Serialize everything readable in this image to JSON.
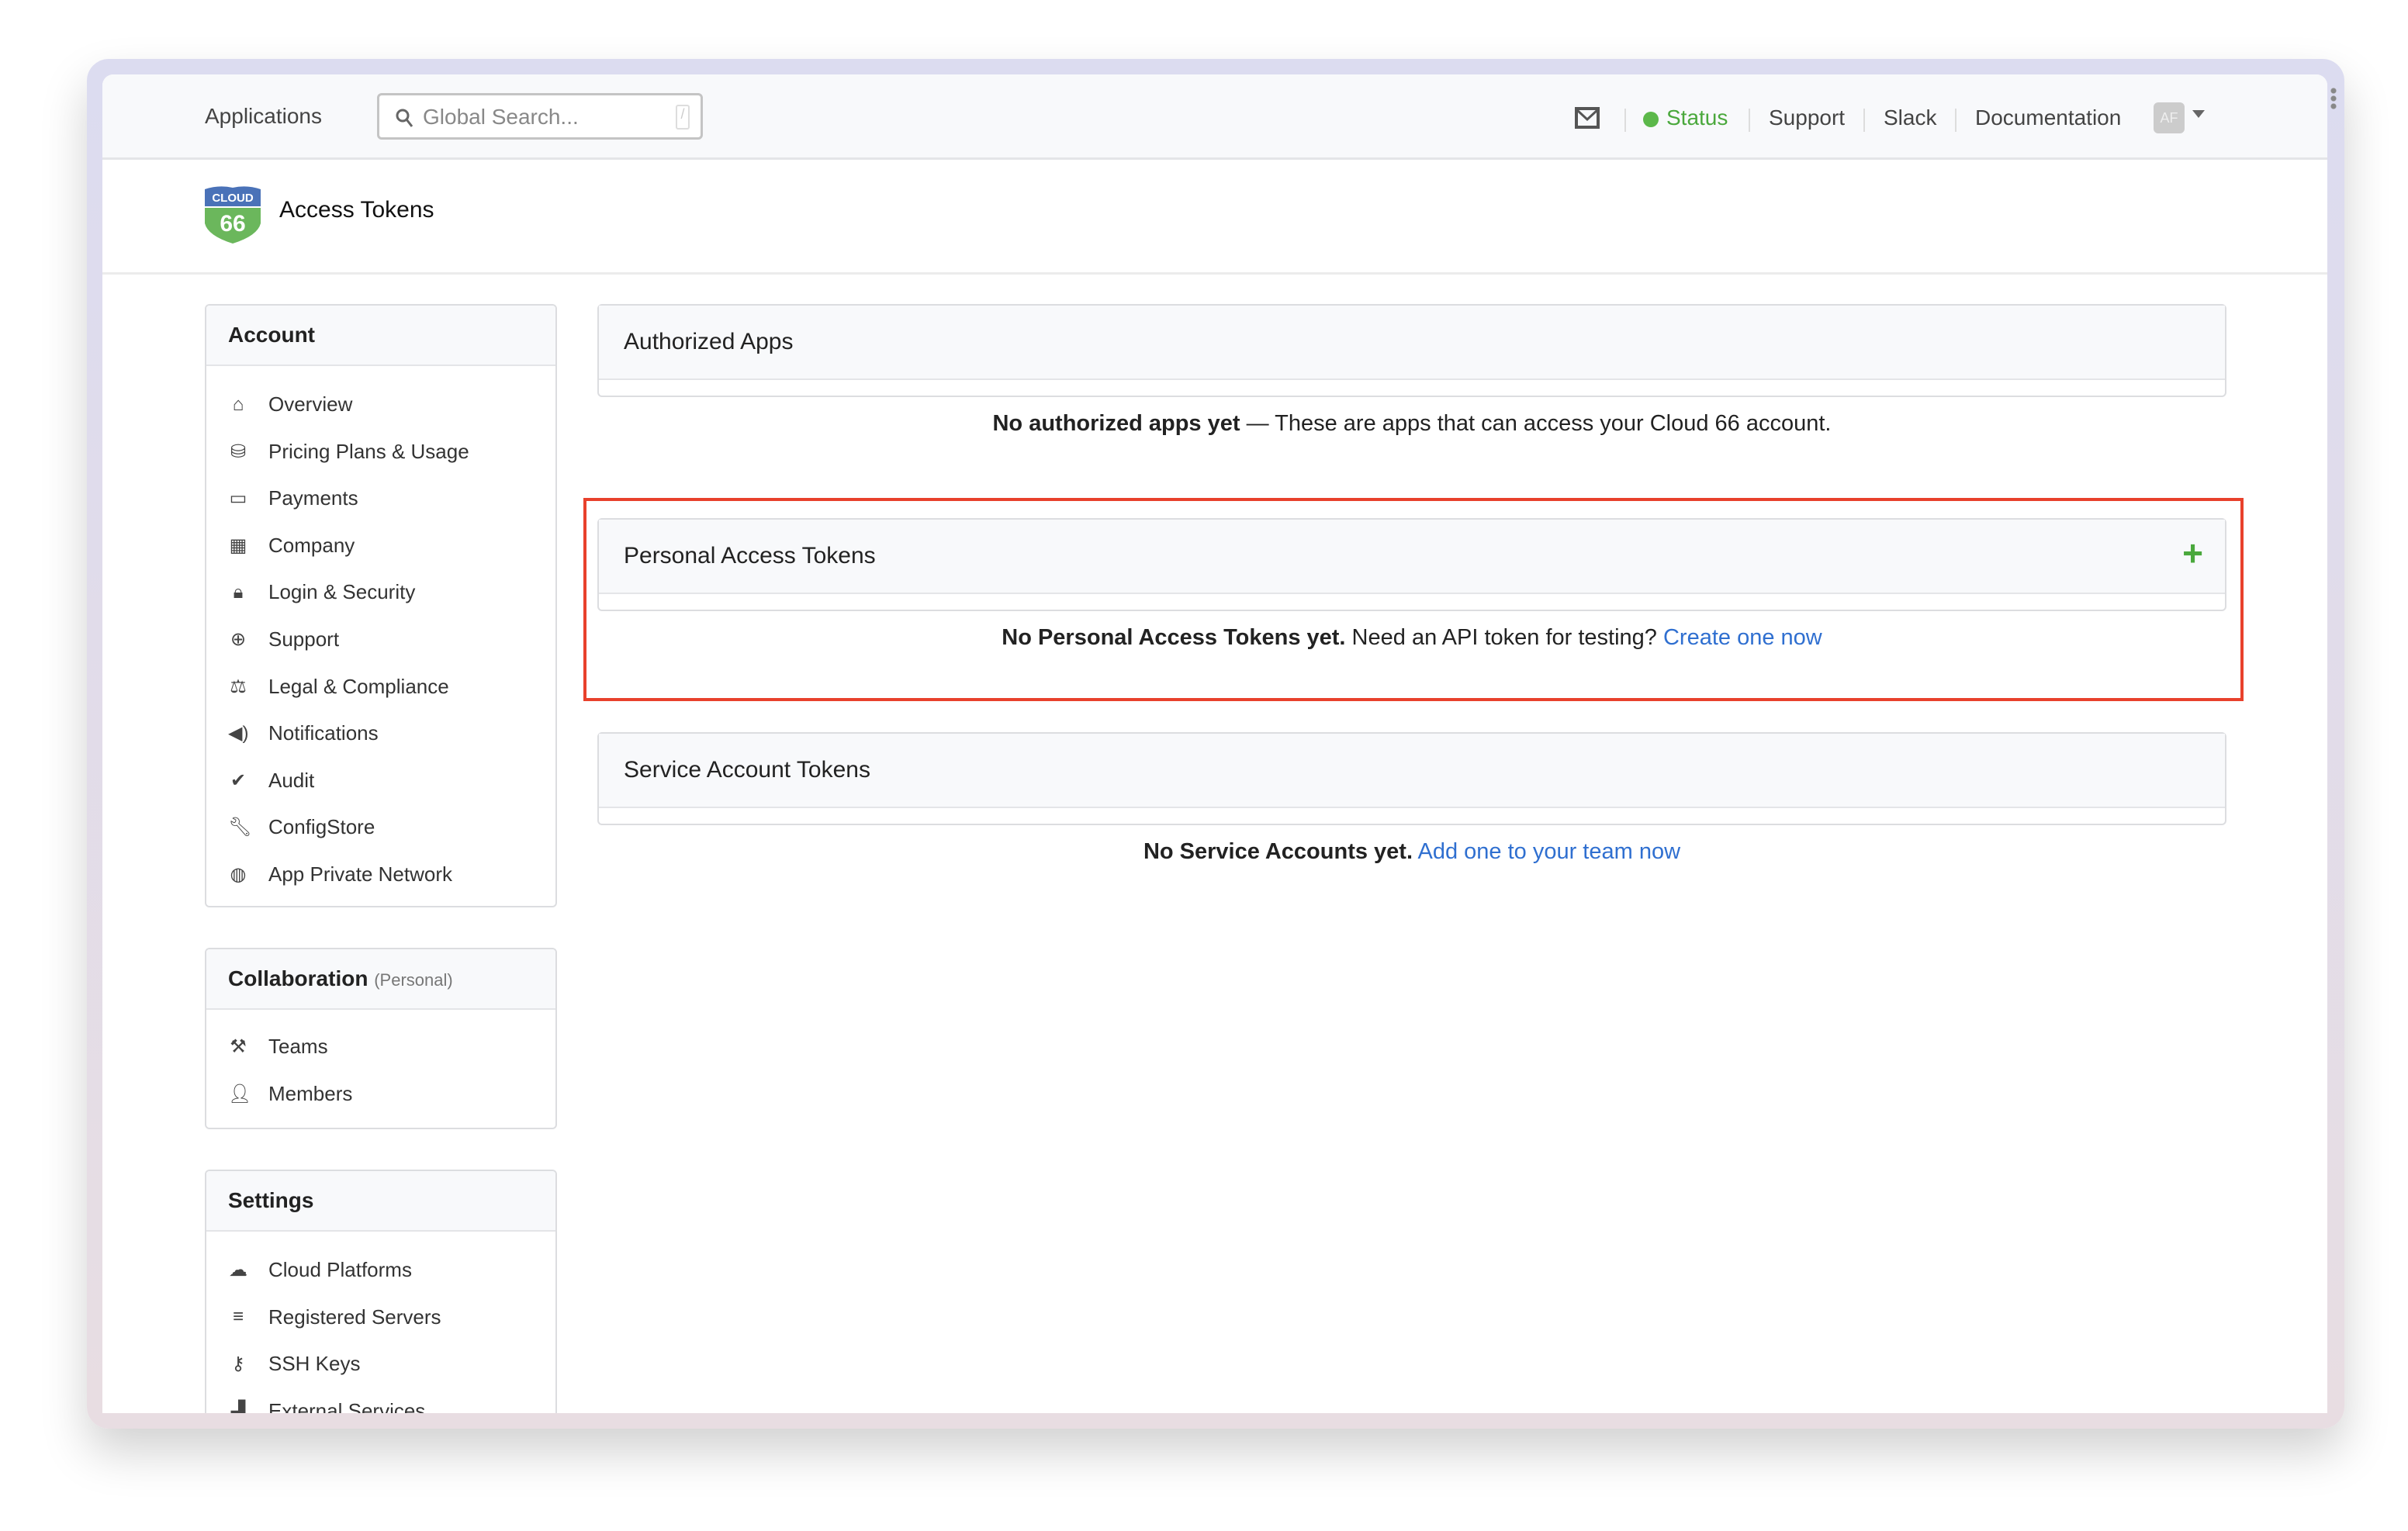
{
  "header": {
    "applications": "Applications",
    "search_placeholder": "Global Search...",
    "search_shortcut": "/",
    "status": "Status",
    "support": "Support",
    "slack": "Slack",
    "documentation": "Documentation",
    "avatar": "AF"
  },
  "logo": {
    "top": "CLOUD",
    "bottom": "66"
  },
  "page_title": "Access Tokens",
  "sidebar": {
    "account": {
      "title": "Account",
      "items": [
        {
          "label": "Overview",
          "icon": "home-icon"
        },
        {
          "label": "Pricing Plans & Usage",
          "icon": "coins-icon"
        },
        {
          "label": "Payments",
          "icon": "credit-card-icon"
        },
        {
          "label": "Company",
          "icon": "building-icon"
        },
        {
          "label": "Login & Security",
          "icon": "lock-icon"
        },
        {
          "label": "Support",
          "icon": "life-ring-icon"
        },
        {
          "label": "Legal & Compliance",
          "icon": "scale-icon"
        },
        {
          "label": "Notifications",
          "icon": "speaker-icon"
        },
        {
          "label": "Audit",
          "icon": "check-icon"
        },
        {
          "label": "ConfigStore",
          "icon": "wrench-icon"
        },
        {
          "label": "App Private Network",
          "icon": "globe-lock-icon"
        }
      ]
    },
    "collaboration": {
      "title": "Collaboration",
      "sub": "(Personal)",
      "items": [
        {
          "label": "Teams",
          "icon": "hammer-icon"
        },
        {
          "label": "Members",
          "icon": "user-icon"
        }
      ]
    },
    "settings": {
      "title": "Settings",
      "items": [
        {
          "label": "Cloud Platforms",
          "icon": "cloud-icon"
        },
        {
          "label": "Registered Servers",
          "icon": "servers-icon"
        },
        {
          "label": "SSH Keys",
          "icon": "key-icon"
        },
        {
          "label": "External Services",
          "icon": "factory-icon"
        }
      ]
    }
  },
  "panels": {
    "authorized": {
      "title": "Authorized Apps",
      "bold": "No authorized apps yet",
      "text": " — These are apps that can access your Cloud 66 account."
    },
    "pat": {
      "title": "Personal Access Tokens",
      "bold": "No Personal Access Tokens yet.",
      "text": " Need an API token for testing? ",
      "link": "Create one now"
    },
    "service": {
      "title": "Service Account Tokens",
      "bold": "No Service Accounts yet.",
      "text": " ",
      "link": "Add one to your team now"
    }
  },
  "colors": {
    "highlight": "#e8412c",
    "link": "#2f6fd0",
    "status": "#5cb84a"
  }
}
